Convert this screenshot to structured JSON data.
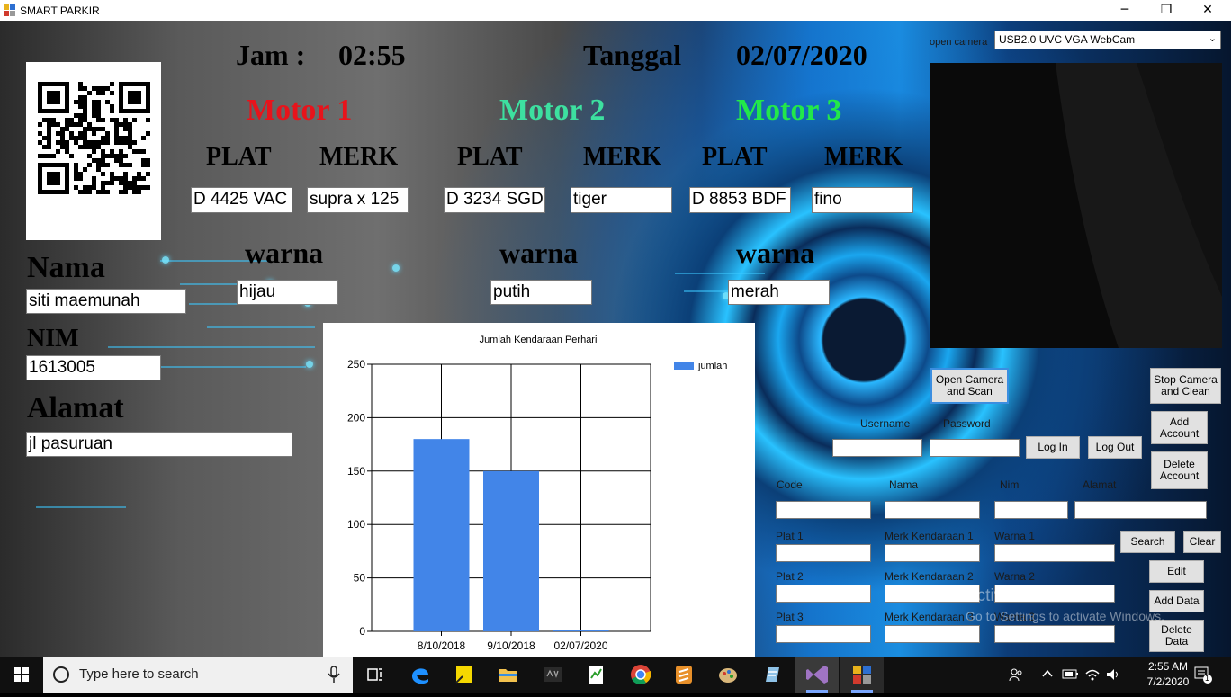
{
  "window": {
    "title": "SMART PARKIR",
    "minimize": "─",
    "maximize": "❐",
    "close": "✕"
  },
  "header": {
    "jam_label": "Jam :",
    "jam_value": "02:55",
    "tanggal_label": "Tanggal",
    "tanggal_value": "02/07/2020"
  },
  "motors": [
    {
      "title": "Motor 1",
      "color": "#e8131b",
      "plat_label": "PLAT",
      "merk_label": "MERK",
      "plat": "D 4425 VAC",
      "merk": "supra x 125",
      "warna_label": "warna",
      "warna": "hijau"
    },
    {
      "title": "Motor 2",
      "color": "#3de0a0",
      "plat_label": "PLAT",
      "merk_label": "MERK",
      "plat": "D 3234 SGD",
      "merk": "tiger",
      "warna_label": "warna",
      "warna": "putih"
    },
    {
      "title": "Motor 3",
      "color": "#22e84a",
      "plat_label": "PLAT",
      "merk_label": "MERK",
      "plat": "D 8853 BDF",
      "merk": "fino",
      "warna_label": "warna",
      "warna": "merah"
    }
  ],
  "person": {
    "nama_label": "Nama",
    "nama": "siti maemunah",
    "nim_label": "NIM",
    "nim": "1613005",
    "alamat_label": "Alamat",
    "alamat": "jl pasuruan"
  },
  "chart_data": {
    "type": "bar",
    "title": "Jumlah Kendaraan Perhari",
    "categories": [
      "8/10/2018",
      "9/10/2018",
      "02/07/2020"
    ],
    "series": [
      {
        "name": "jumlah",
        "values": [
          180,
          150,
          1
        ],
        "color": "#4285e8"
      }
    ],
    "ylim": [
      0,
      250
    ],
    "yticks": [
      0,
      50,
      100,
      150,
      200,
      250
    ],
    "xlabel": "",
    "ylabel": "",
    "grid": true,
    "legend": "top-right"
  },
  "camera": {
    "open_label": "open camera",
    "device": "USB2.0 UVC VGA WebCam",
    "open_scan": "Open Camera and Scan",
    "stop_clean": "Stop Camera and Clean"
  },
  "account": {
    "username_label": "Username",
    "password_label": "Password",
    "login": "Log In",
    "logout": "Log Out",
    "add": "Add Account",
    "delete": "Delete Account"
  },
  "form": {
    "code": "Code",
    "nama": "Nama",
    "nim": "Nim",
    "alamat": "Alamat",
    "plat1": "Plat 1",
    "merk1": "Merk Kendaraan 1",
    "warna1": "Warna 1",
    "plat2": "Plat 2",
    "merk2": "Merk Kendaraan 2",
    "warna2": "Warna 2",
    "plat3": "Plat 3",
    "merk3": "Merk Kendaraan 3",
    "warna3": "Warna 3",
    "search": "Search",
    "clear": "Clear",
    "edit": "Edit",
    "add_data": "Add Data",
    "delete_data": "Delete Data"
  },
  "watermark": {
    "line1": "Activate Windows",
    "line2": "Go to Settings to activate Windows."
  },
  "taskbar": {
    "search_placeholder": "Type here to search",
    "time": "2:55 AM",
    "date": "7/2/2020",
    "notifications": "1"
  }
}
